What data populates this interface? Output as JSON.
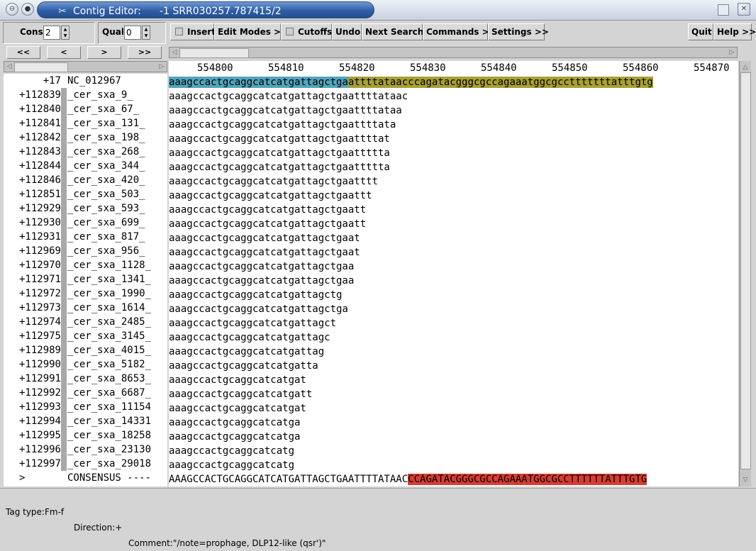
{
  "window": {
    "title": "Contig Editor:",
    "subtitle": "-1 SRR030257.787415/2",
    "menu_glyph": "⊖",
    "pin_glyph": "●",
    "app_glyph": "✂"
  },
  "toolbar": {
    "cons_label": "Cons",
    "cons_value": "2",
    "qual_label": "Qual",
    "qual_value": "0",
    "insert_label": "Insert",
    "edit_modes_label": "Edit Modes >>",
    "cutoffs_label": "Cutoffs",
    "undo_label": "Undo",
    "next_search_label": "Next Search",
    "commands_label": "Commands >>",
    "settings_label": "Settings >>",
    "quit_label": "Quit",
    "help_label": "Help >>",
    "nav": [
      "<<",
      "<",
      ">",
      ">>"
    ]
  },
  "ruler": [
    "554800",
    "554810",
    "554820",
    "554830",
    "554840",
    "554850",
    "554860",
    "554870"
  ],
  "reference": {
    "num": "+17",
    "name": "NC_012967",
    "seq_highlight_blue": "aaagccactgcaggcatcatgattagctga",
    "seq_highlight_olive": "attttataacccagatacgggcgccagaaatggcgcctttttttatttgtg"
  },
  "reads": [
    {
      "num": "+112839",
      "name": "_cer_sxa_9_",
      "seq": "aaagccactgcaggcatcatgattagctgaattttataac"
    },
    {
      "num": "+112840",
      "name": "_cer_sxa_67_",
      "seq": "aaagccactgcaggcatcatgattagctgaattttataa"
    },
    {
      "num": "+112841",
      "name": "_cer_sxa_131_",
      "seq": "aaagccactgcaggcatcatgattagctgaattttata"
    },
    {
      "num": "+112842",
      "name": "_cer_sxa_198_",
      "seq": "aaagccactgcaggcatcatgattagctgaattttat"
    },
    {
      "num": "+112843",
      "name": "_cer_sxa_268_",
      "seq": "aaagccactgcaggcatcatgattagctgaattttta"
    },
    {
      "num": "+112844",
      "name": "_cer_sxa_344_",
      "seq": "aaagccactgcaggcatcatgattagctgaattttta"
    },
    {
      "num": "+112846",
      "name": "_cer_sxa_420_",
      "seq": "aaagccactgcaggcatcatgattagctgaatttt"
    },
    {
      "num": "+112851",
      "name": "_cer_sxa_503_",
      "seq": "aaagccactgcaggcatcatgattagctgaattt"
    },
    {
      "num": "+112929",
      "name": "_cer_sxa_593_",
      "seq": "aaagccactgcaggcatcatgattagctgaatt"
    },
    {
      "num": "+112930",
      "name": "_cer_sxa_699_",
      "seq": "aaagccactgcaggcatcatgattagctgaatt"
    },
    {
      "num": "+112931",
      "name": "_cer_sxa_817_",
      "seq": "aaagccactgcaggcatcatgattagctgaat"
    },
    {
      "num": "+112969",
      "name": "_cer_sxa_956_",
      "seq": "aaagccactgcaggcatcatgattagctgaat"
    },
    {
      "num": "+112970",
      "name": "_cer_sxa_1128_",
      "seq": "aaagccactgcaggcatcatgattagctgaa"
    },
    {
      "num": "+112971",
      "name": "_cer_sxa_1341_",
      "seq": "aaagccactgcaggcatcatgattagctgaa"
    },
    {
      "num": "+112972",
      "name": "_cer_sxa_1990_",
      "seq": "aaagccactgcaggcatcatgattagctg"
    },
    {
      "num": "+112973",
      "name": "_cer_sxa_1614_",
      "seq": "aaagccactgcaggcatcatgattagctga"
    },
    {
      "num": "+112974",
      "name": "_cer_sxa_2485_",
      "seq": "aaagccactgcaggcatcatgattagct"
    },
    {
      "num": "+112975",
      "name": "_cer_sxa_3145_",
      "seq": "aaagccactgcaggcatcatgattagc"
    },
    {
      "num": "+112989",
      "name": "_cer_sxa_4015_",
      "seq": "aaagccactgcaggcatcatgattag"
    },
    {
      "num": "+112990",
      "name": "_cer_sxa_5182_",
      "seq": "aaagccactgcaggcatcatgatta"
    },
    {
      "num": "+112991",
      "name": "_cer_sxa_8653_",
      "seq": "aaagccactgcaggcatcatgat"
    },
    {
      "num": "+112992",
      "name": "_cer_sxa_6687_",
      "seq": "aaagccactgcaggcatcatgatt"
    },
    {
      "num": "+112993",
      "name": "_cer_sxa_11154",
      "seq": "aaagccactgcaggcatcatgat"
    },
    {
      "num": "+112994",
      "name": "_cer_sxa_14331",
      "seq": "aaagccactgcaggcatcatga"
    },
    {
      "num": "+112995",
      "name": "_cer_sxa_18258",
      "seq": "aaagccactgcaggcatcatga"
    },
    {
      "num": "+112996",
      "name": "_cer_sxa_23130",
      "seq": "aaagccactgcaggcatcatg"
    },
    {
      "num": "+112997",
      "name": "_cer_sxa_29018",
      "seq": "aaagccactgcaggcatcatg"
    }
  ],
  "consensus": {
    "marker": ">",
    "label": "CONSENSUS ----",
    "seq_plain": "AAAGCCACTGCAGGCATCATGATTAGCTGAATTTTATAAC",
    "seq_red": "CCAGATACGGGCGCCAGAAATGGCGCCTTTTTTATTTGTG"
  },
  "status": {
    "tag_type": "Tag type:Fm-f",
    "direction": "Direction:+",
    "comment": "Comment:\"/note=prophage, DLP12-like (qsr')\""
  },
  "colors": {
    "highlight_blue": "#52a5bb",
    "highlight_olive": "#a8a032",
    "consensus_red": "#d73d32",
    "title_blue": "#2f5da6"
  }
}
